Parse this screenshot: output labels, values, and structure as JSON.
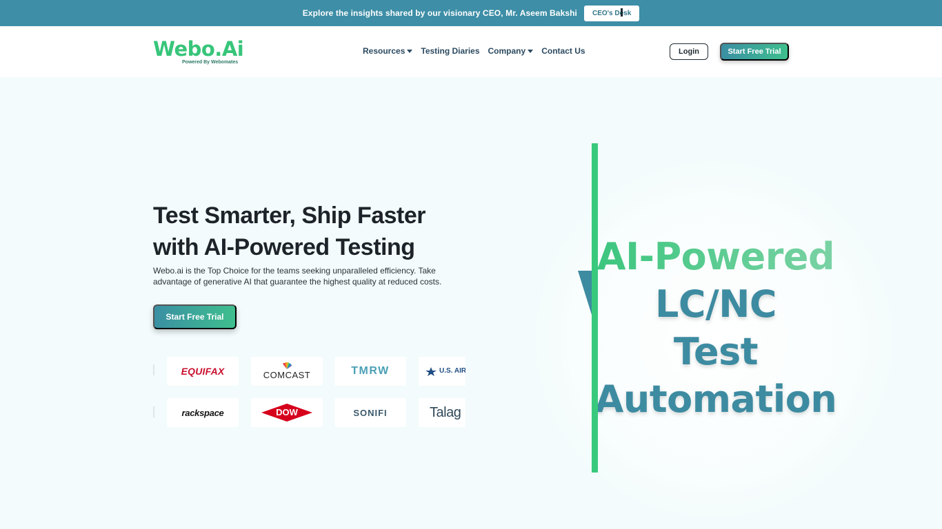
{
  "announcement": {
    "text": "Explore the insights shared by our visionary CEO, Mr. Aseem Bakshi",
    "button_label": "CEO's Desk"
  },
  "brand": {
    "name": "Webo.Ai",
    "tagline": "Powered By Webomates",
    "accent": "#37c57a",
    "primary": "#3d8ea6"
  },
  "nav": {
    "items": [
      {
        "label": "Resources",
        "has_dropdown": true
      },
      {
        "label": "Testing Diaries",
        "has_dropdown": false
      },
      {
        "label": "Company",
        "has_dropdown": true
      },
      {
        "label": "Contact Us",
        "has_dropdown": false
      }
    ],
    "login_label": "Login",
    "trial_label": "Start Free Trial"
  },
  "hero": {
    "title_line1": "Test Smarter, Ship Faster",
    "title_line2": "with AI-Powered Testing",
    "description": "Webo.ai is the Top Choice for the teams seeking unparalleled efficiency. Take advantage of generative AI that guarantee the highest quality at reduced costs.",
    "cta_label": "Start Free Trial"
  },
  "client_logos": {
    "row1": [
      "EQUIFAX",
      "COMCAST",
      "TMRW",
      "U.S. AIR FO"
    ],
    "row2": [
      "rackspace",
      "DOW",
      "SONIFI",
      "Talag"
    ]
  },
  "hero_art": {
    "lines": [
      "AI-Powered",
      "LC/NC",
      "Test",
      "Automation"
    ]
  }
}
